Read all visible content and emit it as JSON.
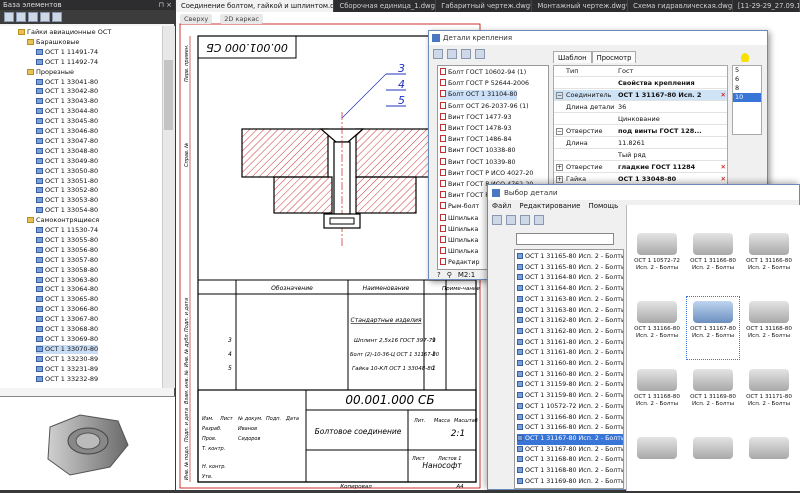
{
  "left_panel": {
    "title": "База элементов",
    "pin": "⊓ ×",
    "tree": [
      {
        "label": "Гайки авиационные ОСТ",
        "type": "folder",
        "indent": 2
      },
      {
        "label": "Барашковые",
        "type": "folder",
        "indent": 3
      },
      {
        "label": "ОСТ 1 11491-74",
        "type": "item",
        "indent": 4
      },
      {
        "label": "ОСТ 1 11492-74",
        "type": "item",
        "indent": 4
      },
      {
        "label": "Прорезные",
        "type": "folder",
        "indent": 3
      },
      {
        "label": "ОСТ 1 33041-80",
        "type": "item",
        "indent": 4
      },
      {
        "label": "ОСТ 1 33042-80",
        "type": "item",
        "indent": 4
      },
      {
        "label": "ОСТ 1 33043-80",
        "type": "item",
        "indent": 4
      },
      {
        "label": "ОСТ 1 33044-80",
        "type": "item",
        "indent": 4
      },
      {
        "label": "ОСТ 1 33045-80",
        "type": "item",
        "indent": 4
      },
      {
        "label": "ОСТ 1 33046-80",
        "type": "item",
        "indent": 4
      },
      {
        "label": "ОСТ 1 33047-80",
        "type": "item",
        "indent": 4
      },
      {
        "label": "ОСТ 1 33048-80",
        "type": "item",
        "indent": 4
      },
      {
        "label": "ОСТ 1 33049-80",
        "type": "item",
        "indent": 4
      },
      {
        "label": "ОСТ 1 33050-80",
        "type": "item",
        "indent": 4
      },
      {
        "label": "ОСТ 1 33051-80",
        "type": "item",
        "indent": 4
      },
      {
        "label": "ОСТ 1 33052-80",
        "type": "item",
        "indent": 4
      },
      {
        "label": "ОСТ 1 33053-80",
        "type": "item",
        "indent": 4
      },
      {
        "label": "ОСТ 1 33054-80",
        "type": "item",
        "indent": 4
      },
      {
        "label": "Самоконтрящиеся",
        "type": "folder",
        "indent": 3
      },
      {
        "label": "ОСТ 1 11530-74",
        "type": "item",
        "indent": 4
      },
      {
        "label": "ОСТ 1 33055-80",
        "type": "item",
        "indent": 4
      },
      {
        "label": "ОСТ 1 33056-80",
        "type": "item",
        "indent": 4
      },
      {
        "label": "ОСТ 1 33057-80",
        "type": "item",
        "indent": 4
      },
      {
        "label": "ОСТ 1 33058-80",
        "type": "item",
        "indent": 4
      },
      {
        "label": "ОСТ 1 33063-80",
        "type": "item",
        "indent": 4
      },
      {
        "label": "ОСТ 1 33064-80",
        "type": "item",
        "indent": 4
      },
      {
        "label": "ОСТ 1 33065-80",
        "type": "item",
        "indent": 4
      },
      {
        "label": "ОСТ 1 33066-80",
        "type": "item",
        "indent": 4
      },
      {
        "label": "ОСТ 1 33067-80",
        "type": "item",
        "indent": 4
      },
      {
        "label": "ОСТ 1 33068-80",
        "type": "item",
        "indent": 4
      },
      {
        "label": "ОСТ 1 33069-80",
        "type": "item",
        "indent": 4
      },
      {
        "label": "ОСТ 1 33070-80",
        "type": "item",
        "indent": 4,
        "selected": true
      },
      {
        "label": "ОСТ 1 33230-89",
        "type": "item",
        "indent": 4
      },
      {
        "label": "ОСТ 1 33231-89",
        "type": "item",
        "indent": 4
      },
      {
        "label": "ОСТ 1 33232-89",
        "type": "item",
        "indent": 4
      }
    ]
  },
  "tabs": [
    {
      "label": "Соединение болтом, гайкой и шплинтом.dwg*",
      "active": true
    },
    {
      "label": "Сборочная единица_1.dwg*",
      "active": false
    },
    {
      "label": "Габаритный чертеж.dwg*",
      "active": false
    },
    {
      "label": "Монтажный чертеж.dwg*",
      "active": false
    },
    {
      "label": "Схема гидравлическая.dwg*",
      "active": false
    },
    {
      "label": "[11-29-29_27.09.19",
      "active": false
    }
  ],
  "tab_close": "×",
  "viewbar": {
    "view": "Сверху",
    "mode": "2D каркас"
  },
  "drawing": {
    "top_code": "00.001.000 СБ",
    "callouts": [
      "3",
      "4",
      "5"
    ],
    "title_code": "00.001.000 СБ",
    "title_name": "Болтовое соединение",
    "company": "Нанософт",
    "scale": "2:1",
    "format": "А4",
    "copied": "Копировал",
    "spec_headers": [
      "Обозначение",
      "Наименование",
      "Приме-чание"
    ],
    "spec_section": "Стандартные изделия",
    "spec_rows": [
      {
        "pos": "3",
        "name": "Шплинт 2,5х16 ГОСТ 397-79",
        "qty": "1"
      },
      {
        "pos": "4",
        "name": "Болт (2)-10-36-Ц ОСТ 1 31167-80",
        "qty": "1"
      },
      {
        "pos": "5",
        "name": "Гайка 10-КЛ ОСТ 1 33048-80",
        "qty": "1"
      }
    ],
    "side_labels": [
      "Перв. примен.",
      "Справ. №",
      "Подп. и дата",
      "Инв. № дубл.",
      "Взам. инв. №",
      "Подп. и дата",
      "Инв. № подл."
    ],
    "stamp_rows": [
      "Изм.",
      "Лист",
      "№ докум.",
      "Подп.",
      "Дата",
      "Разраб.",
      "Пров.",
      "Т. контр.",
      "Н. контр.",
      "Утв."
    ],
    "stamp_people": [
      "Иванов",
      "Сидоров"
    ],
    "stamp_cols": [
      "Лит.",
      "Масса",
      "Масштаб"
    ],
    "sheet": "Лист",
    "sheets": "Листов 1"
  },
  "win1": {
    "title": "Детали крепления",
    "tab_template": "Шаблон",
    "tab_view": "Просмотр",
    "scale_label": "M2:1",
    "list": [
      "Болт ГОСТ 10602-94 (1)",
      "Болт ГОСТ Р 52644-2006",
      "Болт ОСТ 1 31104-80",
      "Болт ОСТ 26-2037-96 (1)",
      "Винт ГОСТ 1477-93",
      "Винт ГОСТ 1478-93",
      "Винт ГОСТ 1486-84",
      "Винт ГОСТ 10338-80",
      "Винт ГОСТ 10339-80",
      "Винт ГОСТ Р ИСО 4027-20",
      "Винт ГОСТ Р ИСО 4762-20",
      "Винт ГОСТ Р ИСО 8676-20",
      "Рым-болт",
      "Шпилька",
      "Шпилька",
      "Шпилька",
      "Шпилька",
      "Редактир"
    ],
    "list_selected": 2,
    "props": [
      {
        "k": "Тип",
        "v": "Гост",
        "exp": ""
      },
      {
        "k": "",
        "v": "Свойства крепления",
        "exp": "",
        "bold": true
      },
      {
        "k": "Соединитель",
        "v": "ОСТ 1 31167-80 Исп. 2",
        "exp": "−",
        "bold": true,
        "x": true,
        "sel": true
      },
      {
        "k": "Длина детали",
        "v": "36",
        "exp": ""
      },
      {
        "k": "",
        "v": "Цинкование",
        "exp": ""
      },
      {
        "k": "Отверстие",
        "v": "под винты ГОСТ 128...",
        "exp": "−",
        "bold": true
      },
      {
        "k": "Длина",
        "v": "11.8261",
        "exp": ""
      },
      {
        "k": "",
        "v": "Тый ряд",
        "exp": ""
      },
      {
        "k": "Отверстие",
        "v": "гладкие ГОСТ 11284",
        "exp": "+",
        "bold": true,
        "x": true
      },
      {
        "k": "Гайка",
        "v": "ОСТ 1 33048-80",
        "exp": "+",
        "bold": true,
        "x": true
      },
      {
        "k": "",
        "v": "Кадмирование",
        "exp": ""
      }
    ],
    "side_values": [
      "5",
      "6",
      "8",
      "10"
    ],
    "side_selected": 3
  },
  "win2": {
    "title": "Выбор детали",
    "menu": [
      "Файл",
      "Редактирование",
      "Помощь"
    ],
    "list": [
      "ОСТ 1 31165-80 Исп. 2 - Болты",
      "ОСТ 1 31165-80 Исп. 2 - Болты с пота",
      "ОСТ 1 31164-80 Исп. 2 - Болты с пота",
      "ОСТ 1 31164-80 Исп. 2 - Болты с пота",
      "ОСТ 1 31163-80 Исп. 2 - Болты с пота",
      "ОСТ 1 31163-80 Исп. 2 - Болты с пота",
      "ОСТ 1 31162-80 Исп. 2 - Болты с пота",
      "ОСТ 1 31162-80 Исп. 2 - Болты с пота",
      "ОСТ 1 31161-80 Исп. 2 - Болты с пота",
      "ОСТ 1 31161-80 Исп. 2 - Болты с пота",
      "ОСТ 1 31160-80 Исп. 2 - Болты с пота",
      "ОСТ 1 31160-80 Исп. 2 - Болты с пота",
      "ОСТ 1 31159-80 Исп. 2 - Болты с пота",
      "ОСТ 1 31159-80 Исп. 2 - Болты с пота",
      "ОСТ 1 10572-72 Исп. 2 - Болты с пота",
      "ОСТ 1 31166-80 Исп. 2 - Болты с пота",
      "ОСТ 1 31166-80 Исп. 2 - Болты с пота",
      "ОСТ 1 31167-80 Исп. 2 - Болты",
      "ОСТ 1 31167-80 Исп. 2 - Болты с пота",
      "ОСТ 1 31168-80 Исп. 2 - Болты с пота",
      "ОСТ 1 31168-80 Исп. 2 - Болты с пота",
      "ОСТ 1 31169-80 Исп. 2 - Болты с пота"
    ],
    "list_selected": 17,
    "gallery": [
      {
        "label": "ОСТ 1 10572-72 Исп. 2 - Болты",
        "sel": false
      },
      {
        "label": "ОСТ 1 31166-80 Исп. 2 - Болты",
        "sel": false
      },
      {
        "label": "ОСТ 1 31166-80 Исп. 2 - Болты",
        "sel": false
      },
      {
        "label": "ОСТ 1 31166-80 Исп. 2 - Болты",
        "sel": false
      },
      {
        "label": "ОСТ 1 31167-80 Исп. 2 - Болты",
        "sel": true
      },
      {
        "label": "ОСТ 1 31168-80 Исп. 2 - Болты",
        "sel": false
      },
      {
        "label": "ОСТ 1 31168-80 Исп. 2 - Болты",
        "sel": false
      },
      {
        "label": "ОСТ 1 31169-80 Исп. 2 - Болты",
        "sel": false
      },
      {
        "label": "ОСТ 1 31171-80 Исп. 2 - Болты",
        "sel": false
      },
      {
        "label": "",
        "sel": false
      },
      {
        "label": "",
        "sel": false
      },
      {
        "label": "",
        "sel": false
      }
    ]
  },
  "colors": {
    "hatch": "#c00000",
    "selection": "#3875d7",
    "dark_chrome": "#2d2d30"
  }
}
